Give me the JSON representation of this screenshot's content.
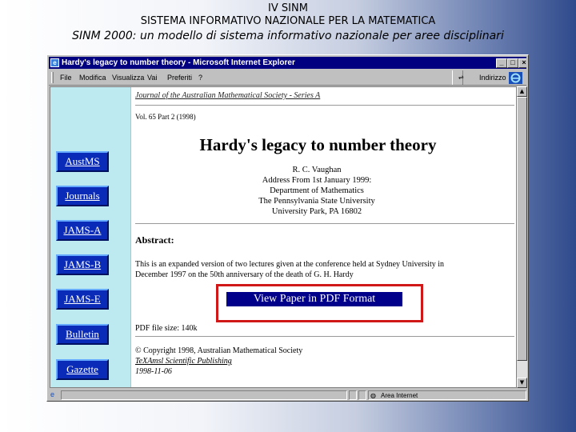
{
  "slide": {
    "title1": "IV SINM",
    "title2": "SISTEMA INFORMATIVO NAZIONALE PER LA MATEMATICA",
    "title3": "SINM 2000: un modello di sistema informativo nazionale per aree disciplinari"
  },
  "window": {
    "title": "Hardy's legacy to number theory - Microsoft Internet Explorer",
    "menu": [
      "File",
      "Modifica",
      "Visualizza",
      "Vai",
      "Preferiti",
      "?"
    ],
    "address_label": "Indirizzo",
    "status_text": "Area Internet"
  },
  "nav": {
    "items": [
      "AustMS",
      "Journals",
      "JAMS-A",
      "JAMS-B",
      "JAMS-E",
      "Bulletin",
      "Gazette"
    ]
  },
  "page": {
    "journal": "Journal of the Australian Mathematical Society - Series A",
    "volume": "Vol. 65 Part 2 (1998)",
    "title": "Hardy's legacy to number theory",
    "author": "R. C. Vaughan",
    "address": [
      "Address From 1st January 1999:",
      "Department of Mathematics",
      "The Pennsylvania State University",
      "University Park, PA 16802"
    ],
    "abstract_heading": "Abstract:",
    "abstract_lines": [
      "This is an expanded version of two lectures given at the conference held at Sydney University in",
      "December 1997 on the 50th anniversary of the death of G. H. Hardy"
    ],
    "pdf_link": "View Paper in PDF Format",
    "pdf_size": "PDF file size: 140k",
    "copyright": "© Copyright 1998, Australian Mathematical Society",
    "publisher": "TeXAmsl Scientific Publishing",
    "date": "1998-11-06"
  },
  "colors": {
    "nav_background": "#bde9f0",
    "nav_button": "#0a2bb8",
    "titlebar": "#000080",
    "highlight": "#d11818"
  }
}
